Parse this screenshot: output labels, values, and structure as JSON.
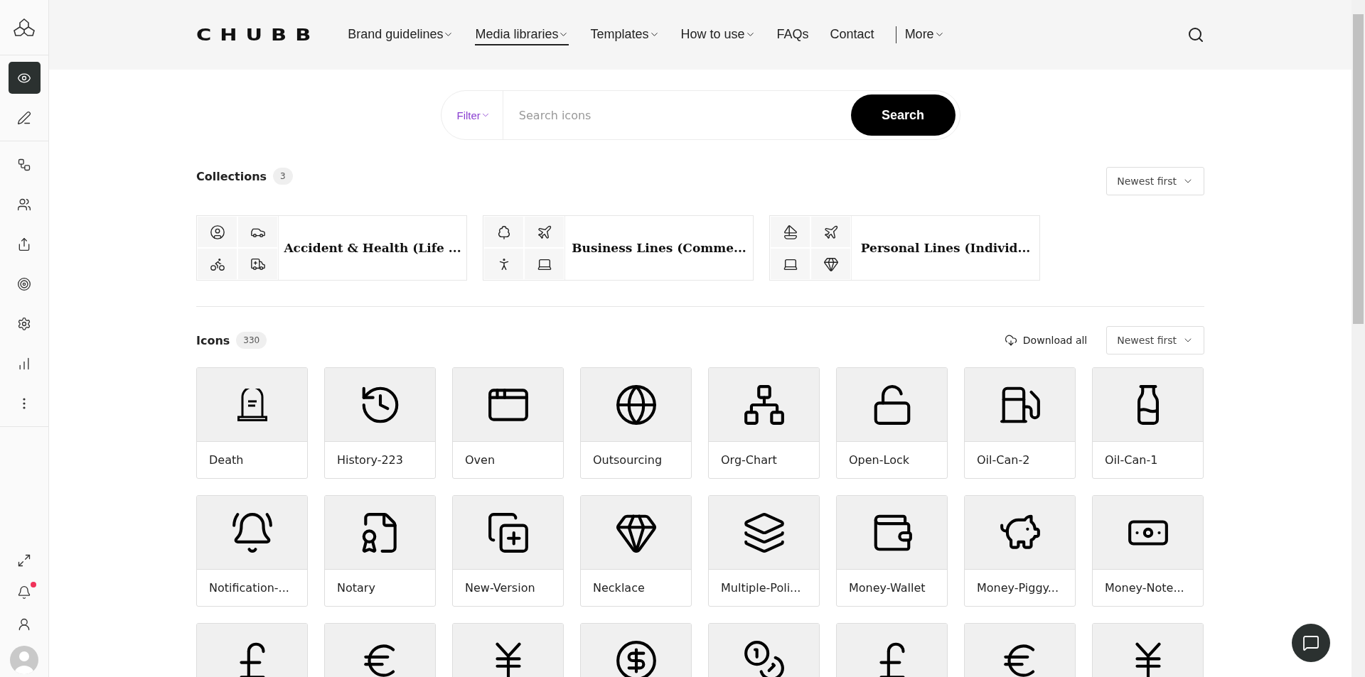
{
  "sidebar": {
    "items": [
      {
        "selected": true
      },
      {
        "selected": false
      },
      {
        "selected": false
      },
      {
        "selected": false
      },
      {
        "selected": false
      },
      {
        "selected": false
      },
      {
        "selected": false
      },
      {
        "selected": false
      },
      {
        "selected": false
      }
    ],
    "bottom": [
      {
        "badge": false
      },
      {
        "badge": true
      },
      {
        "badge": false
      }
    ]
  },
  "header": {
    "logo": "CHUBB",
    "nav": [
      {
        "label": "Brand guidelines",
        "dropdown": true,
        "selected": false
      },
      {
        "label": "Media libraries",
        "dropdown": true,
        "selected": true
      },
      {
        "label": "Templates",
        "dropdown": true,
        "selected": false
      },
      {
        "label": "How to use",
        "dropdown": true,
        "selected": false
      },
      {
        "label": "FAQs",
        "dropdown": false,
        "selected": false
      },
      {
        "label": "Contact",
        "dropdown": false,
        "selected": false
      },
      {
        "label": "More",
        "dropdown": true,
        "selected": false,
        "separator": true
      }
    ]
  },
  "search": {
    "filter": "Filter",
    "placeholder": "Search icons",
    "button": "Search"
  },
  "collections": {
    "title": "Collections",
    "count": "3",
    "sort": "Newest first",
    "items": [
      {
        "title": "Accident & Health (Life ..."
      },
      {
        "title": "Business Lines (Comme..."
      },
      {
        "title": "Personal Lines (Individ..."
      }
    ]
  },
  "icons": {
    "title": "Icons",
    "count": "330",
    "download": "Download all",
    "sort": "Newest first",
    "items": [
      {
        "label": "Death"
      },
      {
        "label": "History-223"
      },
      {
        "label": "Oven"
      },
      {
        "label": "Outsourcing"
      },
      {
        "label": "Org-Chart"
      },
      {
        "label": "Open-Lock"
      },
      {
        "label": "Oil-Can-2"
      },
      {
        "label": "Oil-Can-1"
      },
      {
        "label": "Notification-..."
      },
      {
        "label": "Notary"
      },
      {
        "label": "New-Version"
      },
      {
        "label": "Necklace"
      },
      {
        "label": "Multiple-Poli..."
      },
      {
        "label": "Money-Wallet"
      },
      {
        "label": "Money-Piggy..."
      },
      {
        "label": "Money-Note..."
      }
    ]
  }
}
